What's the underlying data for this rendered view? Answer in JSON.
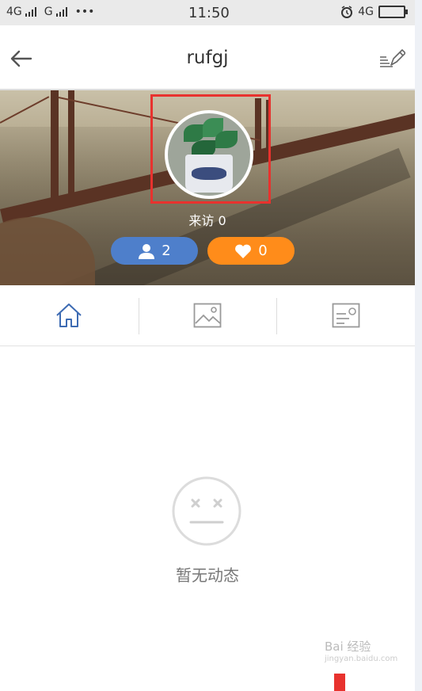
{
  "status_bar": {
    "left_network_1": "4G",
    "left_network_2": "G",
    "dots": "•••",
    "time": "11:50",
    "right_network": "4G"
  },
  "header": {
    "title": "rufgj",
    "back_icon": "back-arrow-icon",
    "edit_icon": "edit-pen-icon"
  },
  "profile": {
    "visits_label": "来访",
    "visits_count": "0",
    "followers_count": "2",
    "likes_count": "0",
    "follower_color": "#4e7fcb",
    "like_color": "#ff8c1a",
    "highlight_color": "#e8322e"
  },
  "tabs": [
    {
      "icon": "home-icon",
      "active": true
    },
    {
      "icon": "image-icon",
      "active": false
    },
    {
      "icon": "profile-card-icon",
      "active": false
    }
  ],
  "empty_state": {
    "icon": "neutral-face-icon",
    "text": "暂无动态"
  },
  "watermark": {
    "line1": "Bai 经验",
    "line2": "jingyan.baidu.com"
  }
}
